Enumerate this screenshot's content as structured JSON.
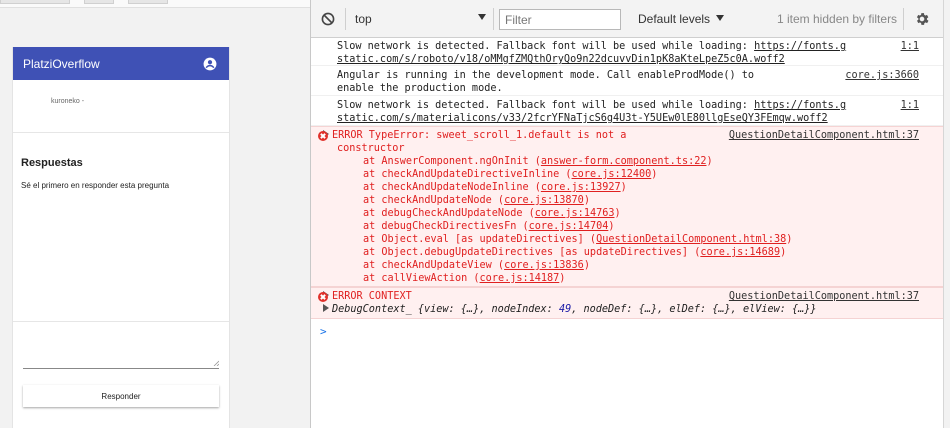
{
  "app": {
    "title": "PlatziOverflow",
    "username": "kuroneko -",
    "answers_heading": "Respuestas",
    "empty_message": "Sé el primero en responder esta pregunta",
    "respond_button": "Responder"
  },
  "toolbar": {
    "context": "top",
    "filter_placeholder": "Filter",
    "levels": "Default levels",
    "hidden": "1 item hidden by filters"
  },
  "console": {
    "messages": [
      {
        "line1": "Slow network is detected. Fallback font will be used while loading: ",
        "url1": "https://fonts.g",
        "url2": "static.com/s/roboto/v18/oMMgfZMQthOryQo9n22dcuvvDin1pK8aKteLpeZ5c0A.woff2",
        "src": "1:1"
      },
      {
        "line1": "Angular is running in the development mode. Call enableProdMode() to",
        "line2": "enable the production mode.",
        "src": "core.js:3660"
      },
      {
        "line1": "Slow network is detected. Fallback font will be used while loading: ",
        "url1": "https://fonts.g",
        "url2": "static.com/s/materialicons/v33/2fcrYFNaTjcS6g4U3t-Y5UEw0lE80llgEseQY3FEmqw.woff2",
        "src": "1:1"
      }
    ],
    "error1": {
      "head": "ERROR TypeError: sweet_scroll_1.default is not a",
      "cont": "constructor",
      "src": "QuestionDetailComponent.html:37",
      "stack": [
        {
          "fn": "at AnswerComponent.ngOnInit (",
          "loc": "answer-form.component.ts:22",
          "end": ")"
        },
        {
          "fn": "at checkAndUpdateDirectiveInline (",
          "loc": "core.js:12400",
          "end": ")"
        },
        {
          "fn": "at checkAndUpdateNodeInline (",
          "loc": "core.js:13927",
          "end": ")"
        },
        {
          "fn": "at checkAndUpdateNode (",
          "loc": "core.js:13870",
          "end": ")"
        },
        {
          "fn": "at debugCheckAndUpdateNode (",
          "loc": "core.js:14763",
          "end": ")"
        },
        {
          "fn": "at debugCheckDirectivesFn (",
          "loc": "core.js:14704",
          "end": ")"
        },
        {
          "fn": "at Object.eval [as updateDirectives] (",
          "loc": "QuestionDetailComponent.html:38",
          "end": ")"
        },
        {
          "fn": "at Object.debugUpdateDirectives [as updateDirectives] (",
          "loc": "core.js:14689",
          "end": ")"
        },
        {
          "fn": "at checkAndUpdateView (",
          "loc": "core.js:13836",
          "end": ")"
        },
        {
          "fn": "at callViewAction (",
          "loc": "core.js:14187",
          "end": ")"
        }
      ]
    },
    "error2": {
      "head": "ERROR CONTEXT",
      "src": "QuestionDetailComponent.html:37",
      "ctx_name": "DebugContext_",
      "ctx_a": " {view: {…}, nodeIndex: ",
      "ctx_num": "49",
      "ctx_b": ", nodeDef: {…}, elDef: {…}, elView: {…}}"
    },
    "prompt": ">"
  },
  "colors": {
    "appbar": "#3f51b5",
    "error_text": "#e02020",
    "error_bg": "#fff0f0",
    "prompt": "#1a73e8"
  },
  "icons": [
    "account-circle-icon",
    "clear-console-icon",
    "dropdown-arrow-icon",
    "settings-gear-icon",
    "error-icon",
    "expand-triangle-icon",
    "resize-grip-icon"
  ]
}
